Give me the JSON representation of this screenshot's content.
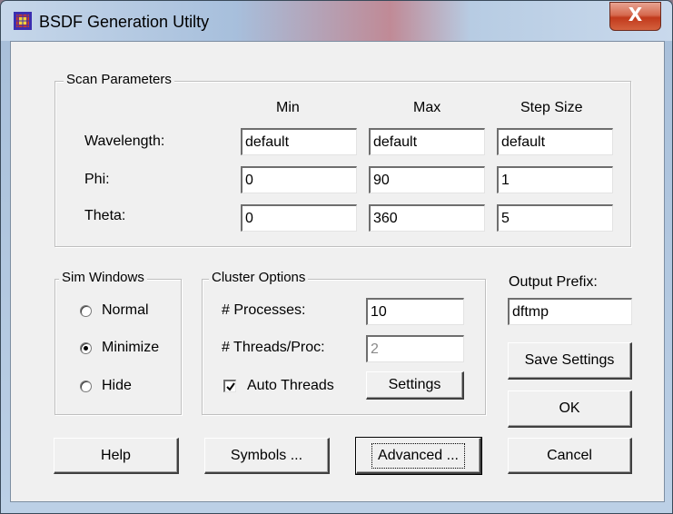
{
  "window": {
    "title": "BSDF Generation Utilty",
    "close_glyph": "X",
    "icon": "grid-app-icon"
  },
  "scan": {
    "legend": "Scan Parameters",
    "headers": [
      "Min",
      "Max",
      "Step Size"
    ],
    "rows": [
      {
        "label": "Wavelength:",
        "min": "default",
        "max": "default",
        "step": "default"
      },
      {
        "label": "Phi:",
        "min": "0",
        "max": "90",
        "step": "1"
      },
      {
        "label": "Theta:",
        "min": "0",
        "max": "360",
        "step": "5"
      }
    ]
  },
  "sim_windows": {
    "legend": "Sim Windows",
    "options": [
      "Normal",
      "Minimize",
      "Hide"
    ],
    "selected": "Minimize"
  },
  "cluster": {
    "legend": "Cluster Options",
    "processes_label": "# Processes:",
    "processes_value": "10",
    "threads_label": "# Threads/Proc:",
    "threads_value": "2",
    "auto_threads_label": "Auto Threads",
    "auto_threads_checked": true,
    "settings_button": "Settings"
  },
  "output": {
    "label": "Output Prefix:",
    "value": "dftmp"
  },
  "buttons": {
    "save_settings": "Save Settings",
    "ok": "OK",
    "help": "Help",
    "symbols": "Symbols ...",
    "advanced": "Advanced ...",
    "cancel": "Cancel"
  }
}
